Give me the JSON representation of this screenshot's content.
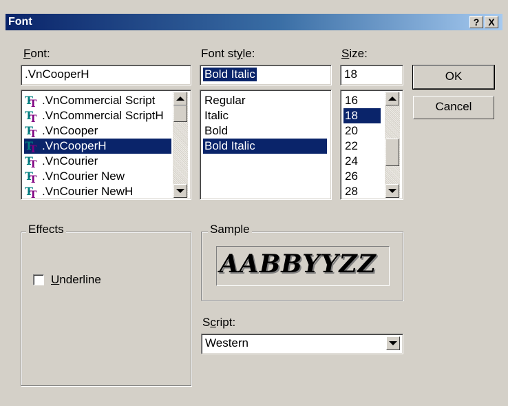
{
  "title": "Font",
  "titlebar_buttons": {
    "help": "?",
    "close": "X"
  },
  "font": {
    "label": "Font:",
    "label_accel": "F",
    "label_rest": "ont:",
    "value": ".VnCooperH",
    "items": [
      {
        "label": ".VnCommercial Script",
        "selected": false
      },
      {
        "label": ".VnCommercial ScriptH",
        "selected": false
      },
      {
        "label": ".VnCooper",
        "selected": false
      },
      {
        "label": ".VnCooperH",
        "selected": true
      },
      {
        "label": ".VnCourier",
        "selected": false
      },
      {
        "label": ".VnCourier New",
        "selected": false
      },
      {
        "label": ".VnCourier NewH",
        "selected": false
      }
    ]
  },
  "style": {
    "label_pre": "Font st",
    "label_accel": "y",
    "label_post": "le:",
    "value": "Bold Italic",
    "items": [
      {
        "label": "Regular",
        "selected": false
      },
      {
        "label": "Italic",
        "selected": false
      },
      {
        "label": "Bold",
        "selected": false
      },
      {
        "label": "Bold Italic",
        "selected": true
      }
    ]
  },
  "size": {
    "label_accel": "S",
    "label_rest": "ize:",
    "value": "18",
    "items": [
      {
        "label": "16",
        "selected": false
      },
      {
        "label": "18",
        "selected": true
      },
      {
        "label": "20",
        "selected": false
      },
      {
        "label": "22",
        "selected": false
      },
      {
        "label": "24",
        "selected": false
      },
      {
        "label": "26",
        "selected": false
      },
      {
        "label": "28",
        "selected": false
      }
    ]
  },
  "buttons": {
    "ok": "OK",
    "cancel": "Cancel"
  },
  "effects": {
    "legend": "Effects",
    "underline_accel": "U",
    "underline_rest": "nderline",
    "underline_checked": false
  },
  "sample": {
    "legend": "Sample",
    "text": "AABBYYZZ"
  },
  "script": {
    "label_pre": "S",
    "label_accel": "c",
    "label_post": "ript:",
    "value": "Western"
  },
  "colors": {
    "selection": "#0a246a",
    "face": "#d4d0c8",
    "icon_dark": "#008080",
    "icon_light": "#800080"
  },
  "icons": {
    "font_type": "truetype-icon"
  }
}
